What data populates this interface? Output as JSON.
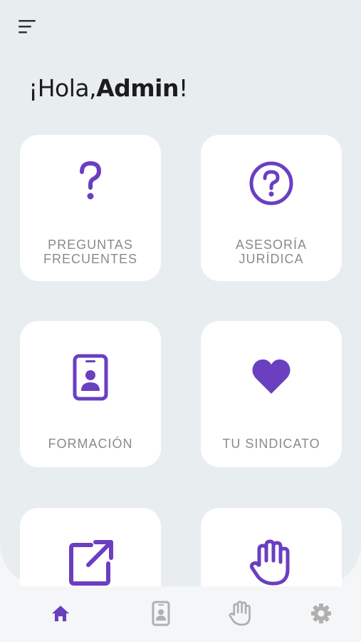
{
  "app": {
    "accent_color": "#6a3fc0",
    "nav_inactive_color": "#b0b0b0"
  },
  "header": {
    "menu_icon": "menu-icon"
  },
  "greeting": {
    "prefix": "¡Hola,",
    "name": "Admin",
    "suffix": "!"
  },
  "cards": [
    {
      "label": "PREGUNTAS\nFRECUENTES",
      "icon": "question-icon"
    },
    {
      "label": "ASESORÍA\nJURÍDICA",
      "icon": "question-circle-icon"
    },
    {
      "label": "FORMACIÓN",
      "icon": "id-badge-icon"
    },
    {
      "label": "TU SINDICATO",
      "icon": "heart-icon"
    },
    {
      "label": "",
      "icon": "external-link-icon"
    },
    {
      "label": "",
      "icon": "hand-icon"
    }
  ],
  "bottom_nav": [
    {
      "icon": "home-icon",
      "active": true
    },
    {
      "icon": "id-badge-icon",
      "active": false
    },
    {
      "icon": "hand-icon",
      "active": false
    },
    {
      "icon": "gear-icon",
      "active": false
    }
  ]
}
